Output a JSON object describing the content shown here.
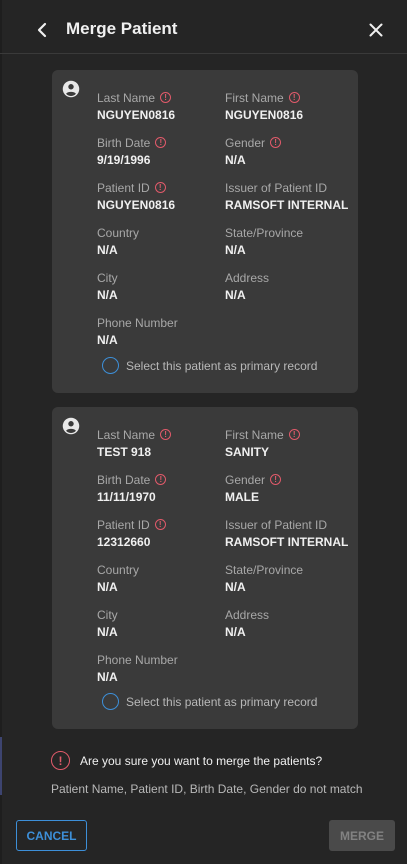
{
  "header": {
    "title": "Merge Patient"
  },
  "labels": {
    "last_name": "Last Name",
    "first_name": "First Name",
    "birth_date": "Birth Date",
    "gender": "Gender",
    "patient_id": "Patient ID",
    "issuer": "Issuer of Patient ID",
    "country": "Country",
    "state": "State/Province",
    "city": "City",
    "address": "Address",
    "phone": "Phone Number",
    "warn_glyph": "!"
  },
  "patients": [
    {
      "last_name": "NGUYEN0816",
      "first_name": "NGUYEN0816",
      "birth_date": "9/19/1996",
      "gender": "N/A",
      "patient_id": "NGUYEN0816",
      "issuer": "RAMSOFT INTERNAL",
      "country": "N/A",
      "state": "N/A",
      "city": "N/A",
      "address": "N/A",
      "phone": "N/A",
      "select_label": "Select this patient as primary record"
    },
    {
      "last_name": "TEST 918",
      "first_name": "SANITY",
      "birth_date": "11/11/1970",
      "gender": "MALE",
      "patient_id": "12312660",
      "issuer": "RAMSOFT INTERNAL",
      "country": "N/A",
      "state": "N/A",
      "city": "N/A",
      "address": "N/A",
      "phone": "N/A",
      "select_label": "Select this patient as primary record"
    }
  ],
  "confirm": {
    "question": "Are you sure you want to merge the patients?",
    "mismatch": "Patient Name, Patient ID, Birth Date, Gender do not match"
  },
  "actions": {
    "cancel_label": "CANCEL",
    "merge_label": "MERGE"
  },
  "colors": {
    "accent": "#3d8fd8",
    "warning": "#e05a6a",
    "card": "#3a3a3a",
    "background": "#252525"
  },
  "icons": [
    "chevron-left-icon",
    "close-icon",
    "account-circle-icon",
    "alert-circle-icon",
    "radio-unchecked-icon"
  ]
}
